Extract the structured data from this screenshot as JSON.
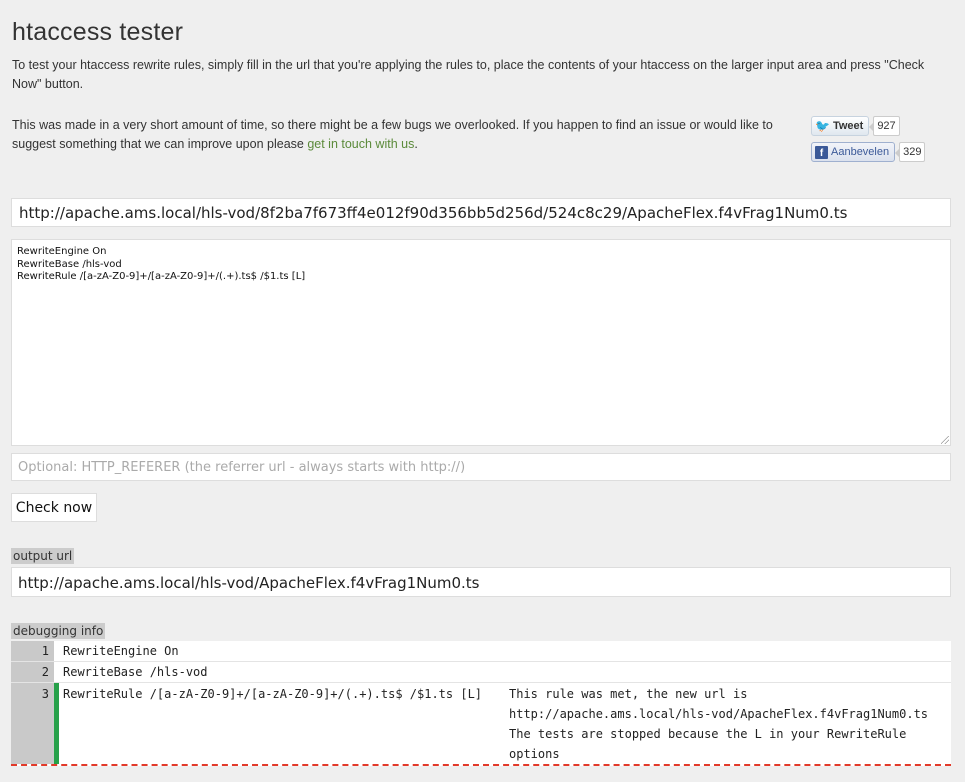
{
  "page": {
    "title": "htaccess tester",
    "intro": "To test your htaccess rewrite rules, simply fill in the url that you're applying the rules to, place the contents of your htaccess on the larger input area and press \"Check Now\" button.",
    "note_before_link": "This was made in a very short amount of time, so there might be a few bugs we overlooked. If you happen to find an issue or would like to suggest something that we can improve upon please ",
    "note_link": "get in touch with us",
    "note_after_link": "."
  },
  "social": {
    "tweet_label": "Tweet",
    "tweet_count": "927",
    "facebook_label": "Aanbevelen",
    "facebook_count": "329"
  },
  "form": {
    "url_value": "http://apache.ams.local/hls-vod/8f2ba7f673ff4e012f90d356bb5d256d/524c8c29/ApacheFlex.f4vFrag1Num0.ts",
    "rules_value": "RewriteEngine On\nRewriteBase /hls-vod\nRewriteRule /[a-zA-Z0-9]+/[a-zA-Z0-9]+/(.+).ts$ /$1.ts [L]",
    "referrer_placeholder": "Optional: HTTP_REFERER (the referrer url - always starts with http://)",
    "check_button": "Check now"
  },
  "output": {
    "label": "output url",
    "url": "http://apache.ams.local/hls-vod/ApacheFlex.f4vFrag1Num0.ts"
  },
  "debug": {
    "label": "debugging info",
    "rows": [
      {
        "num": "1",
        "rule": "RewriteEngine On"
      },
      {
        "num": "2",
        "rule": "RewriteBase /hls-vod"
      },
      {
        "num": "3",
        "rule": "RewriteRule /[a-zA-Z0-9]+/[a-zA-Z0-9]+/(.+).ts$ /$1.ts [L]",
        "message1": "This rule was met, the new url is http://apache.ams.local/hls-vod/ApacheFlex.f4vFrag1Num0.ts",
        "message2": "The tests are stopped because the L in your RewriteRule options"
      }
    ]
  },
  "colors": {
    "met_marker": "#27a14a",
    "stop_line": "#e23a2a",
    "link": "#5b8a3a"
  }
}
